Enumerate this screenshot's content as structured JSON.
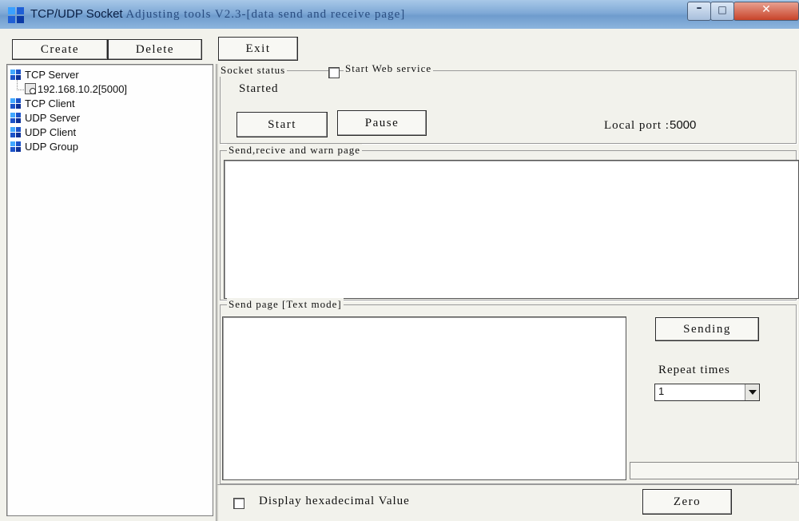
{
  "window": {
    "title_part1": "TCP/UDP Socket",
    "title_part2": "Adjusting tools  V2.3-[data send and receive page]"
  },
  "toolbar": {
    "create_label": "Create",
    "delete_label": "Delete",
    "exit_label": "Exit"
  },
  "tree": {
    "items": [
      {
        "label": "TCP Server"
      },
      {
        "label": "192.168.10.2[5000]"
      },
      {
        "label": "TCP Client"
      },
      {
        "label": "UDP Server"
      },
      {
        "label": "UDP Client"
      },
      {
        "label": "UDP Group"
      }
    ]
  },
  "socket": {
    "group_label": "Socket status",
    "web_service_label": "Start Web service",
    "status_value": "Started",
    "start_label": "Start",
    "pause_label": "Pause",
    "local_port_label": "Local port :",
    "local_port_value": "5000"
  },
  "recv": {
    "group_label": "Send,recive and warn page"
  },
  "send": {
    "group_label": "Send page [Text mode]",
    "sending_label": "Sending",
    "repeat_label": "Repeat times",
    "repeat_value": "1"
  },
  "bottom": {
    "hex_label": "Display hexadecimal Value",
    "zero_label": "Zero"
  }
}
